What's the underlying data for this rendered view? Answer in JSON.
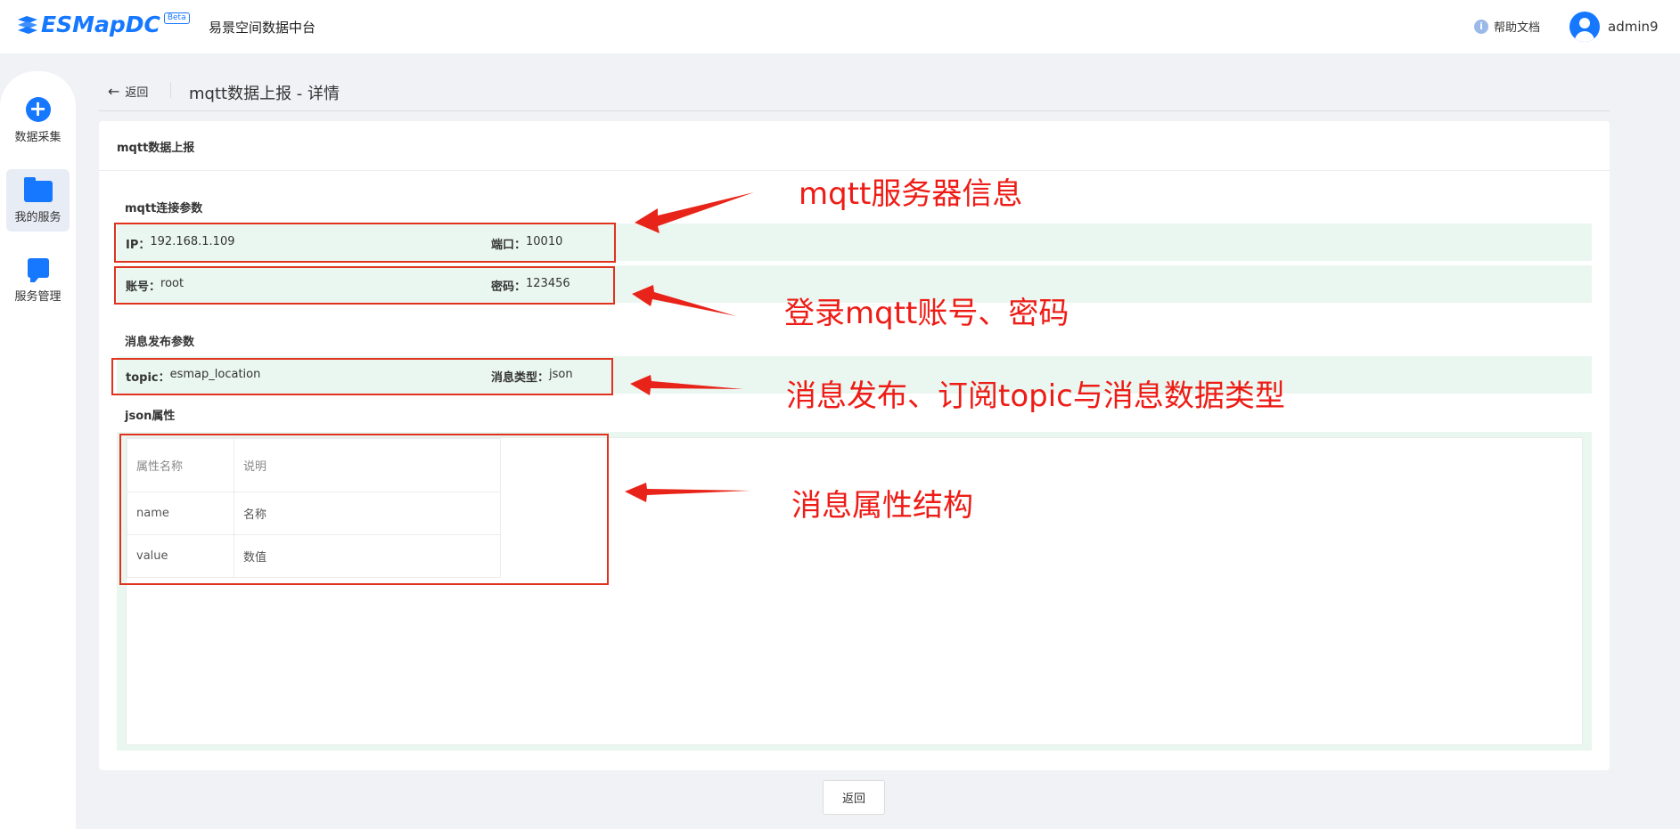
{
  "header": {
    "logo_text": "ESMapDC",
    "logo_badge": "Beta",
    "app_name": "易景空间数据中台",
    "help_label": "帮助文档",
    "help_icon": "i",
    "username": "admin9"
  },
  "sidebar": {
    "items": [
      {
        "label": "数据采集",
        "icon": "plus-circle-icon"
      },
      {
        "label": "我的服务",
        "icon": "folder-icon"
      },
      {
        "label": "服务管理",
        "icon": "bookmark-icon"
      }
    ]
  },
  "breadcrumb": {
    "back_label": "返回",
    "back_arrow": "←",
    "page_title": "mqtt数据上报 - 详情"
  },
  "card": {
    "title": "mqtt数据上报",
    "connection": {
      "section_title": "mqtt连接参数",
      "ip_label": "IP：",
      "ip_value": "192.168.1.109",
      "port_label": "端口：",
      "port_value": "10010",
      "account_label": "账号：",
      "account_value": "root",
      "password_label": "密码：",
      "password_value": "123456"
    },
    "publish": {
      "section_title": "消息发布参数",
      "topic_label": "topic：",
      "topic_value": "esmap_location",
      "type_label": "消息类型：",
      "type_value": "json"
    },
    "json_props": {
      "section_title": "json属性",
      "headers": [
        "属性名称",
        "说明"
      ],
      "rows": [
        [
          "name",
          "名称"
        ],
        [
          "value",
          "数值"
        ]
      ]
    }
  },
  "annotations": {
    "server_info": "mqtt服务器信息",
    "login": "登录mqtt账号、密码",
    "topic": "消息发布、订阅topic与消息数据类型",
    "structure": "消息属性结构",
    "color": "#ee1c16"
  },
  "footer": {
    "back_button": "返回"
  }
}
